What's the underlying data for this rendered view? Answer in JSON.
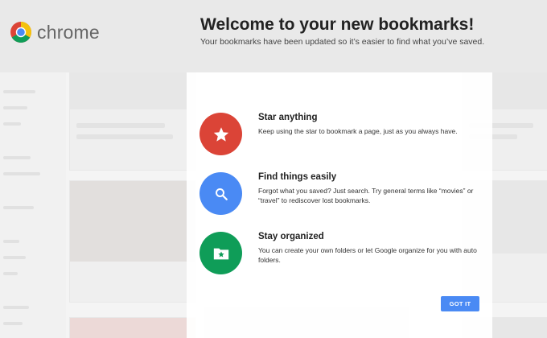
{
  "header": {
    "brand": "chrome",
    "title": "Welcome to your new bookmarks!",
    "subtitle": "Your bookmarks have been updated so it’s easier to find what you’ve saved."
  },
  "features": [
    {
      "title": "Star anything",
      "description": "Keep using the star to bookmark a page, just as you always have.",
      "icon": "star-icon",
      "color": "#db4437"
    },
    {
      "title": "Find things easily",
      "description": "Forgot what you saved? Just search. Try general terms like “movies” or “travel” to rediscover lost bookmarks.",
      "icon": "search-icon",
      "color": "#4a8af4"
    },
    {
      "title": "Stay organized",
      "description": "You can create your own folders or let Google organize for you with auto folders.",
      "icon": "folder-star-icon",
      "color": "#0f9d58"
    }
  ],
  "actions": {
    "got_it_label": "GOT IT"
  },
  "colors": {
    "header_bg": "#e9e9e9",
    "accent_blue": "#4a8af4",
    "accent_red": "#db4437",
    "accent_green": "#0f9d58"
  }
}
